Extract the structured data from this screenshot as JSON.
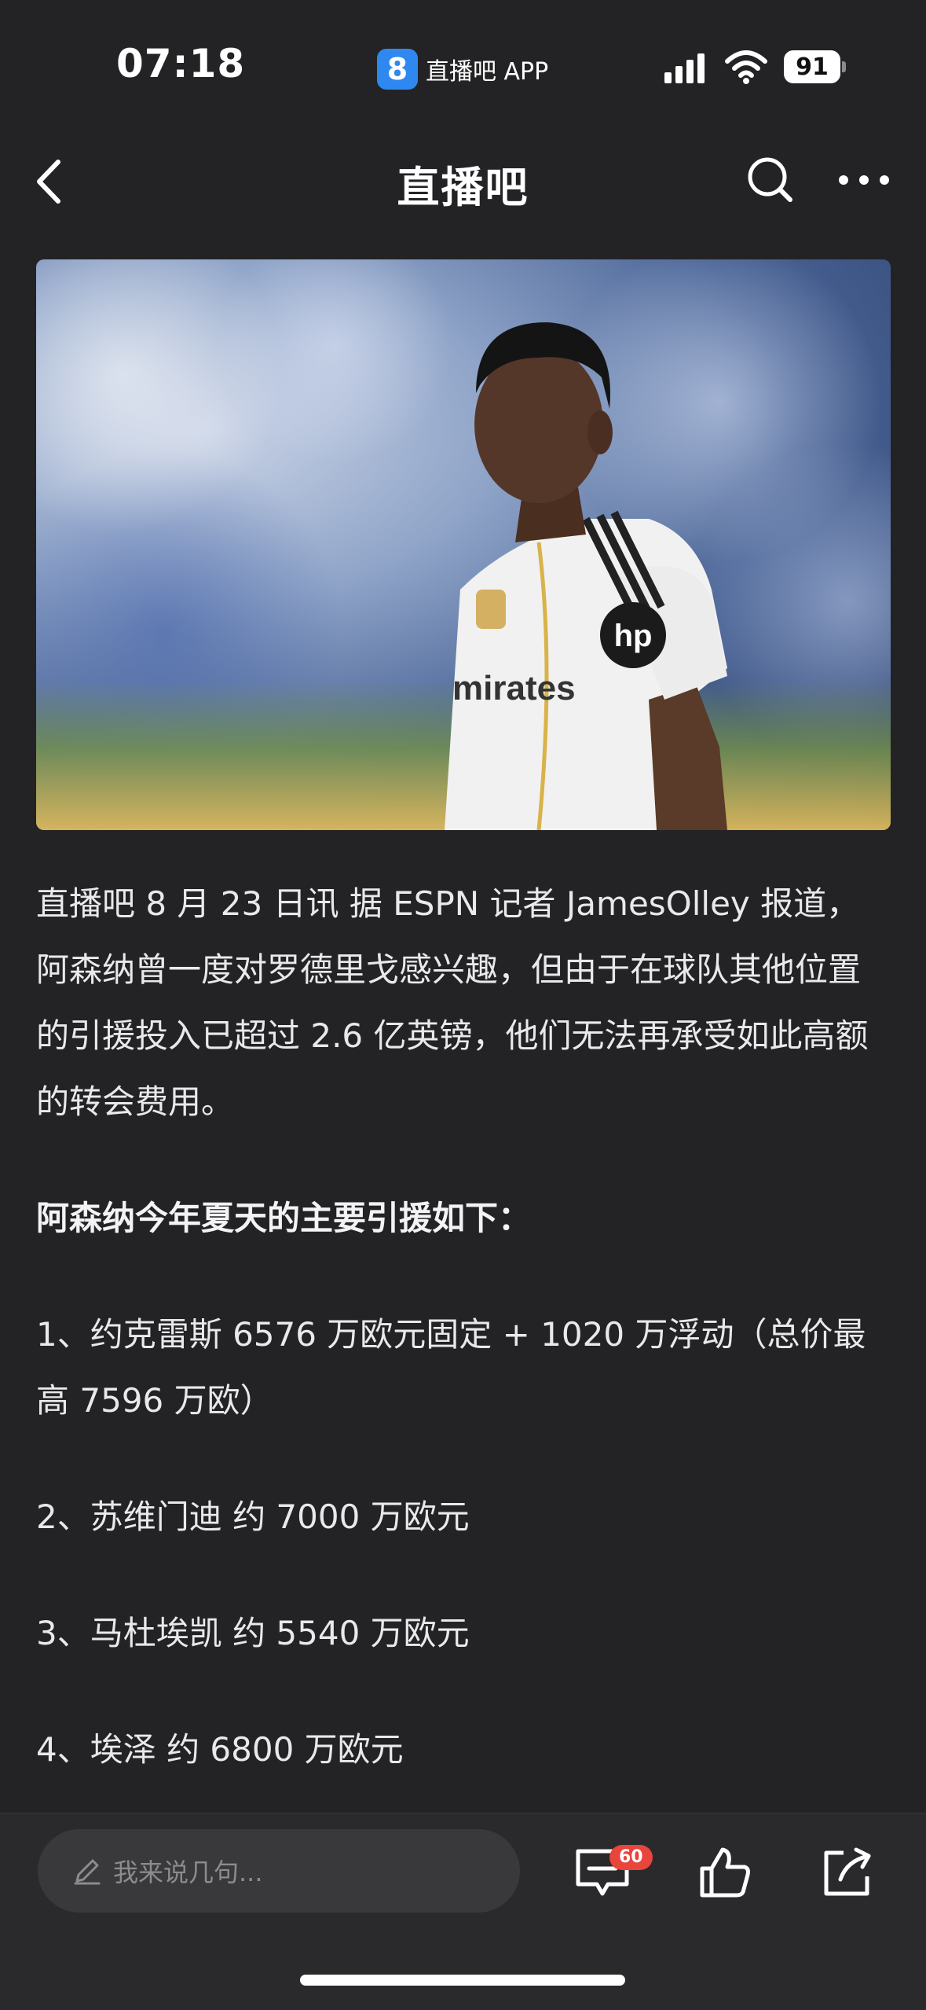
{
  "status_bar": {
    "time": "07:18",
    "app_icon_glyph": "8",
    "app_label": "直播吧 APP",
    "battery": "91"
  },
  "nav": {
    "title": "直播吧",
    "back_icon": "chevron-left-icon",
    "search_icon": "search-icon",
    "more_icon": "more-icon"
  },
  "hero": {
    "description_icon": "player-photo"
  },
  "article": {
    "intro": "直播吧 8 月 23 日讯   据 ESPN 记者 JamesOlley 报道，阿森纳曾一度对罗德里戈感兴趣，但由于在球队其他位置的引援投入已超过 2.6 亿英镑，他们无法再承受如此高额的转会费用。",
    "heading": "阿森纳今年夏天的主要引援如下：",
    "items": [
      "1、约克雷斯 6576 万欧元固定 + 1020 万浮动（总价最高 7596 万欧）",
      "2、苏维门迪 约 7000 万欧元",
      "3、马杜埃凯 约 5540 万欧元",
      "4、埃泽 约 6800 万欧元"
    ]
  },
  "bottom_bar": {
    "comment_placeholder": "我来说几句...",
    "comment_count": "60",
    "icons": [
      "pencil-icon",
      "comment-icon",
      "thumbs-up-icon",
      "share-icon"
    ]
  },
  "colors": {
    "background": "#232325",
    "text": "#e9e9ec",
    "badge": "#e8453c",
    "app_logo": "#2f88f0"
  }
}
